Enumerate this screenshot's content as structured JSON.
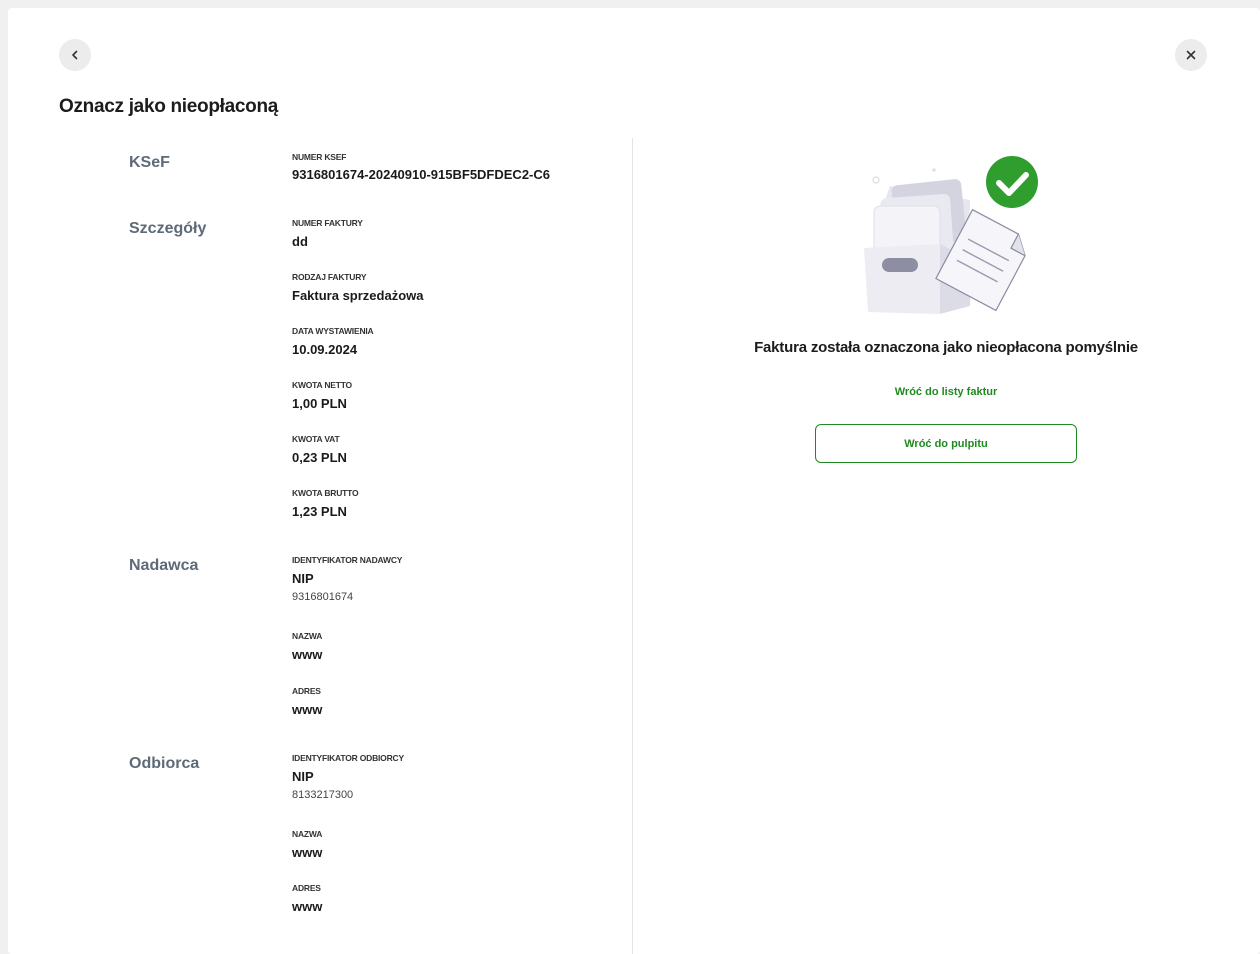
{
  "header": {
    "title": "Oznacz jako nieopłaconą",
    "back_icon": "chevron-left-icon",
    "close_icon": "close-icon"
  },
  "sections": {
    "ksef": {
      "title": "KSeF",
      "number_label": "NUMER KSEF",
      "number_value": "9316801674-20240910-915BF5DFDEC2-C6"
    },
    "details": {
      "title": "Szczegóły",
      "invoice_number_label": "NUMER FAKTURY",
      "invoice_number_value": "dd",
      "invoice_type_label": "RODZAJ FAKTURY",
      "invoice_type_value": "Faktura sprzedażowa",
      "issue_date_label": "DATA WYSTAWIENIA",
      "issue_date_value": "10.09.2024",
      "net_label": "KWOTA NETTO",
      "net_value": "1,00 PLN",
      "vat_label": "KWOTA VAT",
      "vat_value": "0,23 PLN",
      "gross_label": "KWOTA BRUTTO",
      "gross_value": "1,23 PLN"
    },
    "sender": {
      "title": "Nadawca",
      "id_label": "IDENTYFIKATOR NADAWCY",
      "id_type": "NIP",
      "id_value": "9316801674",
      "name_label": "NAZWA",
      "name_value": "www",
      "address_label": "ADRES",
      "address_value": "www"
    },
    "recipient": {
      "title": "Odbiorca",
      "id_label": "IDENTYFIKATOR ODBIORCY",
      "id_type": "NIP",
      "id_value": "8133217300",
      "name_label": "NAZWA",
      "name_value": "www",
      "address_label": "ADRES",
      "address_value": "www"
    }
  },
  "result": {
    "message": "Faktura została oznaczona jako nieopłacona pomyślnie",
    "link_label": "Wróć do listy faktur",
    "button_label": "Wróć do pulpitu",
    "accent_color": "#1f8a1f",
    "illustration_icon": "documents-box-success-icon"
  }
}
